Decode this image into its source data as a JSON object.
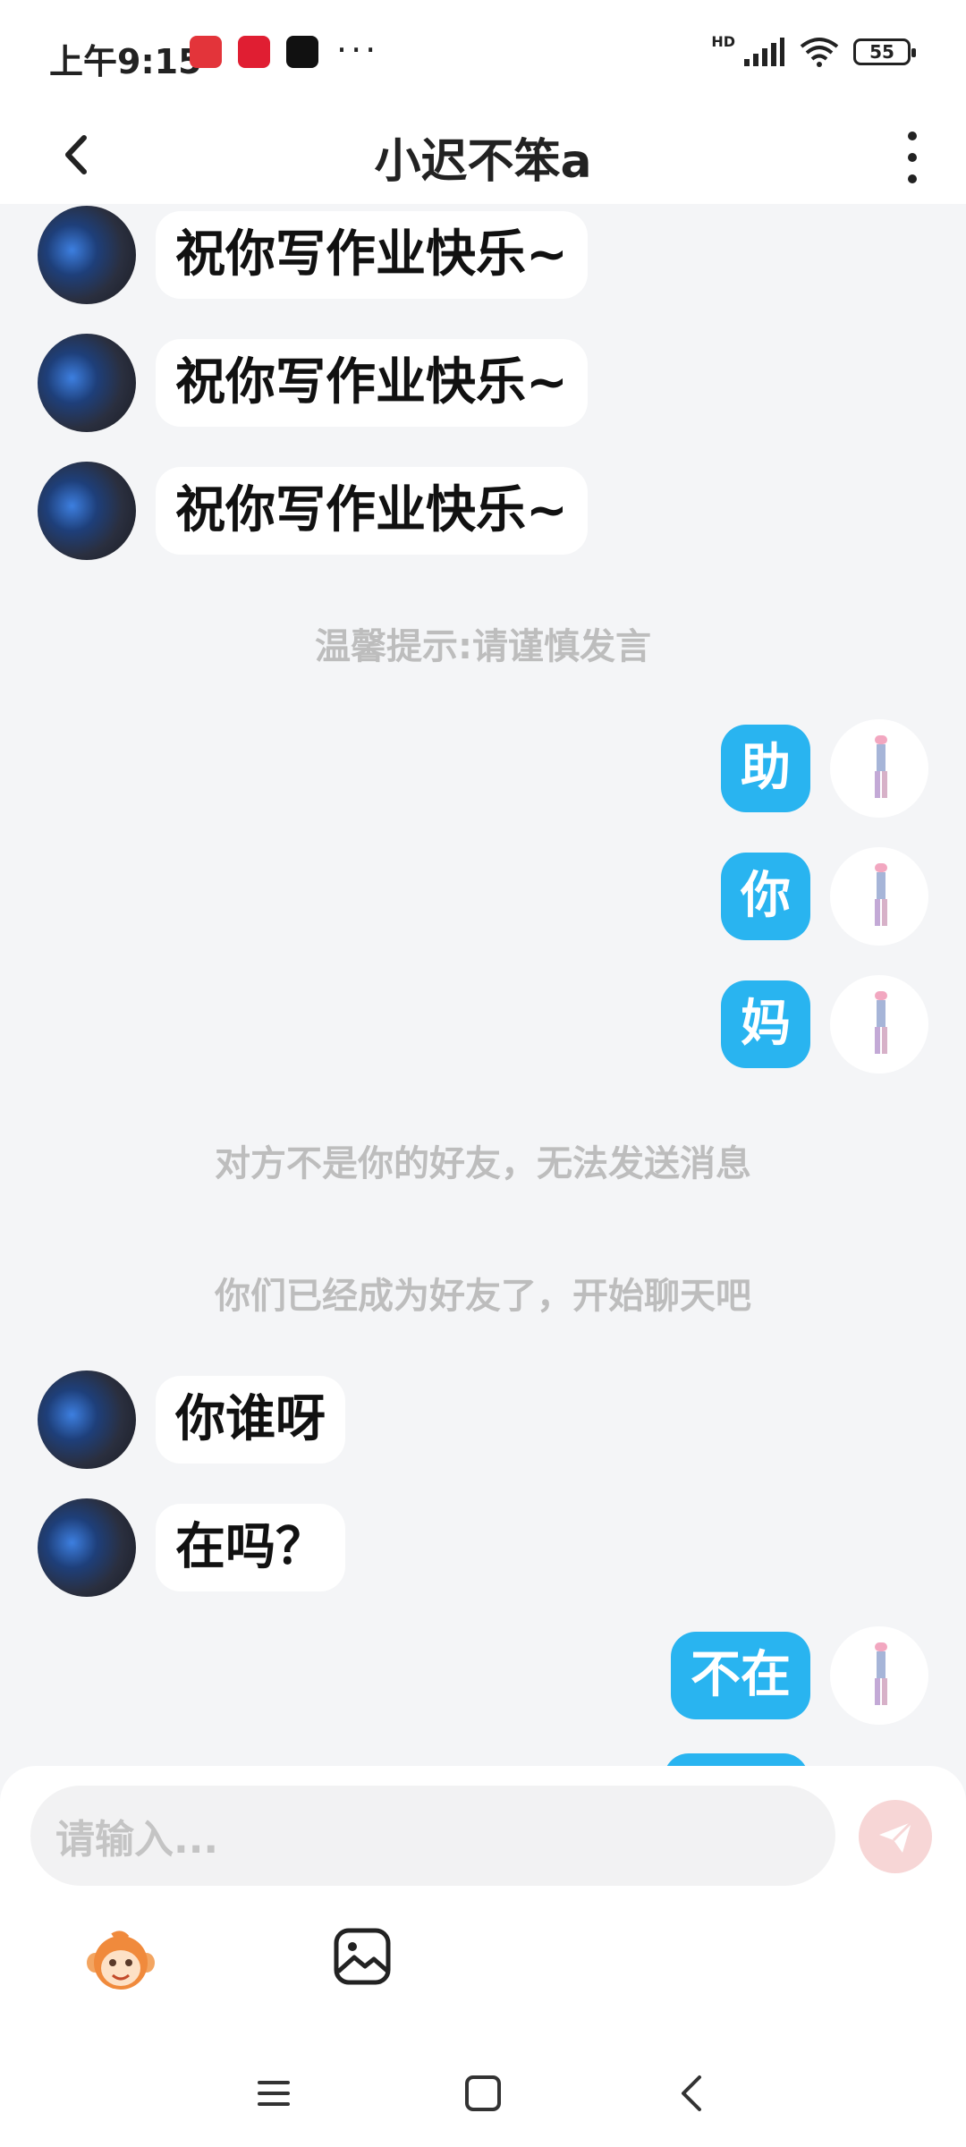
{
  "status_bar": {
    "time": "上午9:15",
    "app_icons": [
      "kandian-app-icon",
      "pinduoduo-app-icon",
      "tiktok-app-icon"
    ],
    "more": "···",
    "network": "HD",
    "battery": "55"
  },
  "header": {
    "title": "小迟不笨a",
    "back_icon": "chevron-left-icon",
    "more_icon": "more-vertical-icon"
  },
  "messages": [
    {
      "side": "left",
      "text": "祝你写作业快乐~"
    },
    {
      "side": "left",
      "text": "祝你写作业快乐~"
    },
    {
      "side": "left",
      "text": "祝你写作业快乐~"
    },
    {
      "type": "notice",
      "text": "温馨提示:请谨慎发言"
    },
    {
      "side": "right",
      "text": "助"
    },
    {
      "side": "right",
      "text": "你"
    },
    {
      "side": "right",
      "text": "妈"
    },
    {
      "type": "notice",
      "text": "对方不是你的好友，无法发送消息"
    },
    {
      "type": "notice",
      "text": "你们已经成为好友了，开始聊天吧"
    },
    {
      "side": "left",
      "text": "你谁呀"
    },
    {
      "side": "left",
      "text": "在吗？"
    },
    {
      "side": "right",
      "text": "不在"
    }
  ],
  "composer": {
    "placeholder": "请输入...",
    "send_icon": "paper-plane-icon",
    "emoji_icon": "monkey-face-icon",
    "image_icon": "image-icon"
  },
  "colors": {
    "outgoing_bubble": "#29b4f0",
    "incoming_bubble": "#ffffff",
    "chat_background": "#f4f5f7",
    "notice_text": "#bdbdbd"
  },
  "nav": {
    "menu_icon": "menu-icon",
    "home_icon": "home-square-icon",
    "back_icon": "back-triangle-icon"
  }
}
